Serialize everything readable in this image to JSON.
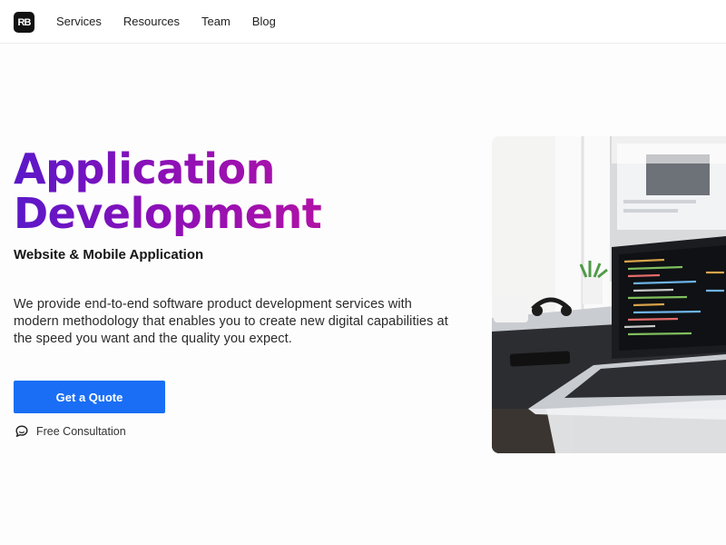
{
  "nav": {
    "logo_text": "RB",
    "links": [
      "Services",
      "Resources",
      "Team",
      "Blog"
    ]
  },
  "hero": {
    "title_line1": "Application",
    "title_line2": "Development",
    "subtitle": "Website & Mobile Application",
    "description": "We provide end-to-end software product development services with modern methodology that enables you to create new digital capabilities at the speed you want and the quality you expect.",
    "cta_label": "Get a Quote",
    "consult_label": "Free Consultation",
    "image_alt": "laptop-on-desk-photo"
  },
  "colors": {
    "accent": "#1a6ef5",
    "gradient_start": "#5a18c9",
    "gradient_end": "#b012a6"
  },
  "icons": {
    "logo": "brand-logo-icon",
    "consult": "chat-bubble-icon"
  }
}
